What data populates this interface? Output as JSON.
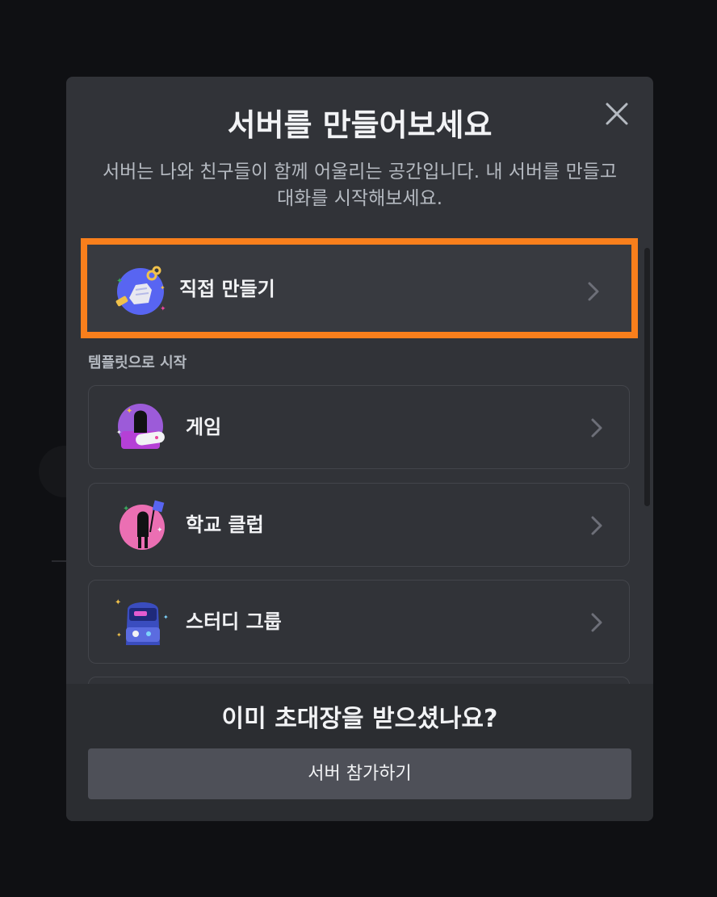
{
  "modal": {
    "title": "서버를 만들어보세요",
    "subtitle": "서버는 나와 친구들이 함께 어울리는 공간입니다. 내 서버를 만들고 대화를 시작해보세요."
  },
  "create_own": {
    "label": "직접 만들기",
    "icon": "create-own-illustration"
  },
  "templates": {
    "section_label": "템플릿으로 시작",
    "items": [
      {
        "label": "게임",
        "icon": "gaming-illustration"
      },
      {
        "label": "학교 클럽",
        "icon": "school-club-illustration"
      },
      {
        "label": "스터디 그룹",
        "icon": "study-group-illustration"
      }
    ]
  },
  "footer": {
    "title": "이미 초대장을 받으셨나요?",
    "join_label": "서버 참가하기"
  },
  "colors": {
    "accent": "#f97f1c",
    "modal_bg": "#313338",
    "footer_bg": "#2b2d31",
    "button_bg": "#4e5058"
  }
}
